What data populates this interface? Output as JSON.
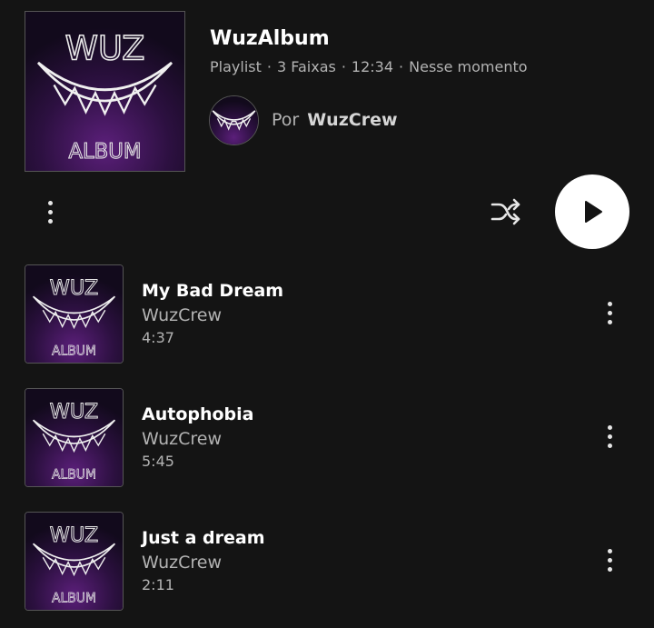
{
  "playlist": {
    "title": "WuzAlbum",
    "type": "Playlist",
    "track_count": "3 Faixas",
    "duration": "12:34",
    "updated": "Nesse momento",
    "owner_prefix": "Por",
    "owner_name": "WuzCrew",
    "cover_text_top": "WUZ",
    "cover_text_bottom": "ALBUM"
  },
  "actions": {
    "more_icon": "more-vert-icon",
    "shuffle_icon": "shuffle-icon",
    "play_icon": "play-icon"
  },
  "tracks": [
    {
      "title": "My Bad Dream",
      "artist": "WuzCrew",
      "duration": "4:37"
    },
    {
      "title": "Autophobia",
      "artist": "WuzCrew",
      "duration": "5:45"
    },
    {
      "title": "Just a dream",
      "artist": "WuzCrew",
      "duration": "2:11"
    }
  ],
  "colors": {
    "background": "#141414",
    "primary_text": "#ffffff",
    "secondary_text": "#b3b3b3",
    "play_button": "#ffffff"
  }
}
